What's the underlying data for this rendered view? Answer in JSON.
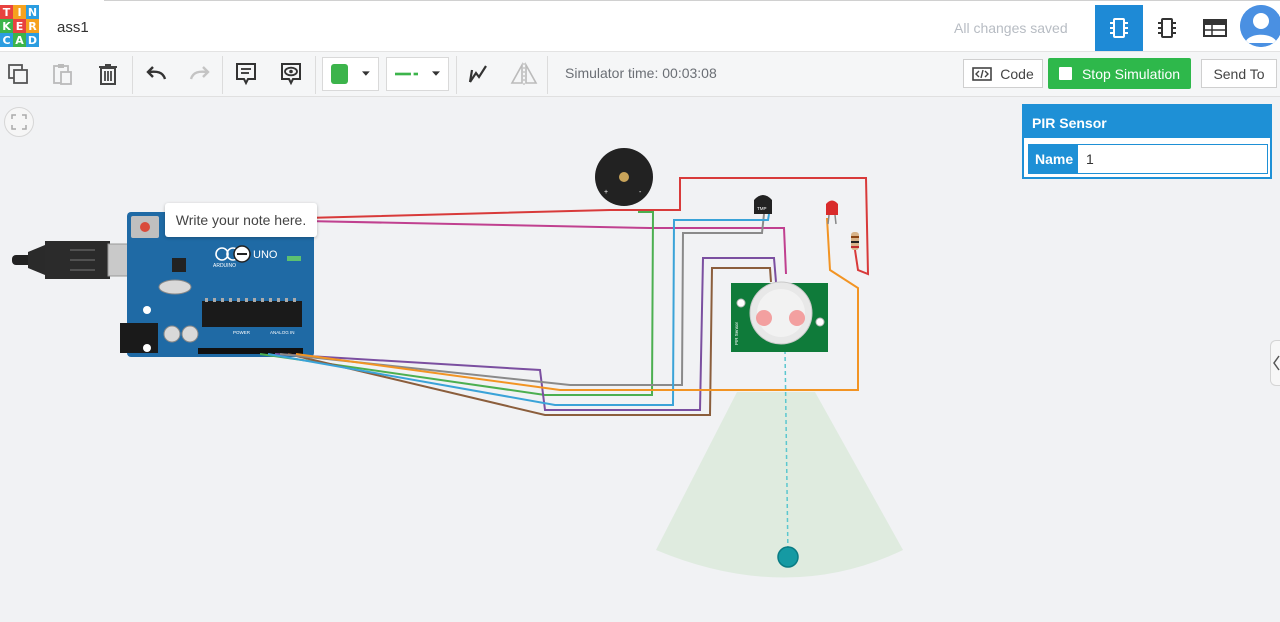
{
  "app": {
    "logo_letters": [
      "T",
      "I",
      "N",
      "K",
      "E",
      "R",
      "C",
      "A",
      "D"
    ],
    "logo_colors": [
      "#e8423f",
      "#f6a21e",
      "#2b9de0",
      "#3cb44b",
      "#e8423f",
      "#f6a21e",
      "#2b9de0",
      "#3cb44b",
      "#2b9de0"
    ],
    "project_name": "ass1",
    "save_status": "All changes saved"
  },
  "header": {
    "view_buttons": [
      {
        "name": "circuit-view",
        "icon": "chip-icon",
        "active": true
      },
      {
        "name": "schematic-view",
        "icon": "schematic-icon",
        "active": false
      },
      {
        "name": "component-list-view",
        "icon": "table-icon",
        "active": false
      }
    ],
    "avatar_icon": "user-avatar-icon"
  },
  "toolbar": {
    "icons": [
      "copy-icon",
      "paste-icon",
      "delete-icon",
      "undo-icon",
      "redo-icon",
      "notes-icon",
      "show-notes-icon",
      "annotate-icon",
      "flip-icon"
    ],
    "wire_color": "#3cb44b",
    "simulator_time": "Simulator time: 00:03:08",
    "code_label": "Code",
    "stop_label": "Stop Simulation",
    "send_label": "Send To"
  },
  "note": {
    "text": "Write your note here."
  },
  "properties": {
    "title": "PIR Sensor",
    "name_label": "Name",
    "name_value": "1"
  },
  "components": {
    "arduino_logo": "UNO",
    "arduino_brand": "ARDUINO",
    "power_label": "POWER",
    "analog_label": "ANALOG IN",
    "tmp_label": "TMP",
    "pir_label": "PIR Sensor"
  },
  "colors": {
    "accent": "#1e90d6",
    "stop_green": "#2eb84b",
    "board_blue": "#1f6aa5",
    "pir_green": "#0f7b3a",
    "wire_red": "#d83a3a",
    "wire_magenta": "#c0408f",
    "wire_green": "#4caf50",
    "wire_orange": "#f29423",
    "wire_purple": "#7b4fa0",
    "wire_brown": "#8b5e3c",
    "wire_gray": "#8a8a8a",
    "wire_blue": "#3aa3d8"
  }
}
